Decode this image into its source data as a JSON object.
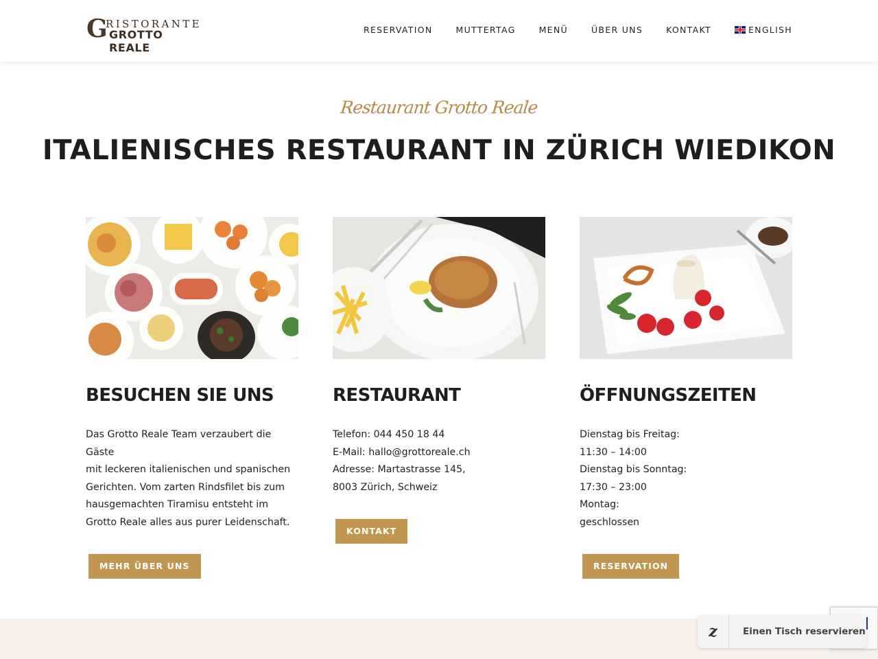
{
  "header": {
    "logo": {
      "letter": "G",
      "line1": "RISTORANTE",
      "line2": "GROTTO REALE"
    },
    "nav": [
      {
        "label": "RESERVATION"
      },
      {
        "label": "MUTTERTAG"
      },
      {
        "label": "MENÜ"
      },
      {
        "label": "ÜBER UNS"
      },
      {
        "label": "KONTAKT"
      },
      {
        "label": "ENGLISH",
        "icon": "uk-flag-icon"
      }
    ]
  },
  "hero": {
    "script_title": "Restaurant Grotto Reale",
    "title": "ITALIENISCHES RESTAURANT IN ZÜRICH WIEDIKON"
  },
  "columns": {
    "visit": {
      "heading": "BESUCHEN SIE UNS",
      "lines": [
        "Das Grotto Reale Team verzaubert die Gäste",
        "mit leckeren italienischen und spanischen",
        "Gerichten. Vom zarten Rindsfilet bis zum",
        "hausgemachten Tiramisu entsteht im",
        "Grotto Reale alles aus purer Leidenschaft."
      ],
      "button": "MEHR ÜBER UNS"
    },
    "restaurant": {
      "heading": "RESTAURANT",
      "lines": [
        "Telefon: 044 450 18 44",
        "E-Mail: hallo@grottoreale.ch",
        "Adresse: Martastrasse 145,",
        "8003 Zürich, Schweiz"
      ],
      "button": "KONTAKT"
    },
    "hours": {
      "heading": "ÖFFNUNGSZEITEN",
      "lines": [
        "Dienstag bis Freitag:",
        "11:30 – 14:00",
        "Dienstag bis Sonntag:",
        "17:30 – 23:00",
        "Montag:",
        "geschlossen"
      ],
      "button": "RESERVATION"
    }
  },
  "widget": {
    "logo_letter": "z",
    "label": "Einen Tisch reservieren"
  },
  "colors": {
    "accent": "#c09651",
    "script": "#b88a47",
    "footer_bg": "#f8f0ea"
  }
}
